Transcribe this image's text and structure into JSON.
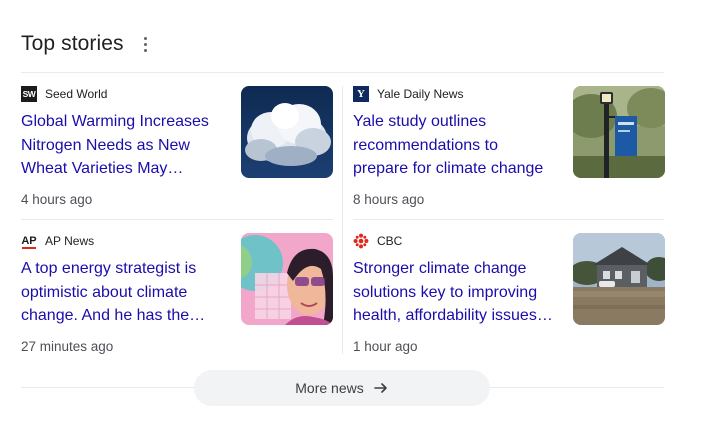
{
  "header": {
    "title": "Top stories",
    "menu_icon": "more-vert-icon"
  },
  "stories": [
    {
      "source": "Seed World",
      "logo_text": "SW",
      "logo_icon": "seed-world-logo",
      "headline": "Global Warming Increases Nitrogen Needs as New Wheat Varieties May…",
      "time": "4 hours ago",
      "thumb_icon": "clouds-image"
    },
    {
      "source": "Yale Daily News",
      "logo_text": "Y",
      "logo_icon": "yale-daily-news-logo",
      "headline": "Yale study outlines recommendations to prepare for climate change",
      "time": "8 hours ago",
      "thumb_icon": "lamp-post-banner-image"
    },
    {
      "source": "AP News",
      "logo_text": "AP",
      "logo_icon": "ap-news-logo",
      "headline": "A top energy strategist is optimistic about climate change. And he has the…",
      "time": "27 minutes ago",
      "thumb_icon": "strategist-illustration-image"
    },
    {
      "source": "CBC",
      "logo_text": "",
      "logo_icon": "cbc-gem-logo",
      "headline": "Stronger climate change solutions key to improving health, affordability issues…",
      "time": "1 hour ago",
      "thumb_icon": "flooded-house-image"
    }
  ],
  "more_news": {
    "label": "More news",
    "icon": "arrow-right-icon"
  },
  "colors": {
    "link": "#1a0dab",
    "secondary": "#4d5156",
    "divider": "#ebebeb",
    "button_bg": "#f1f3f4"
  }
}
